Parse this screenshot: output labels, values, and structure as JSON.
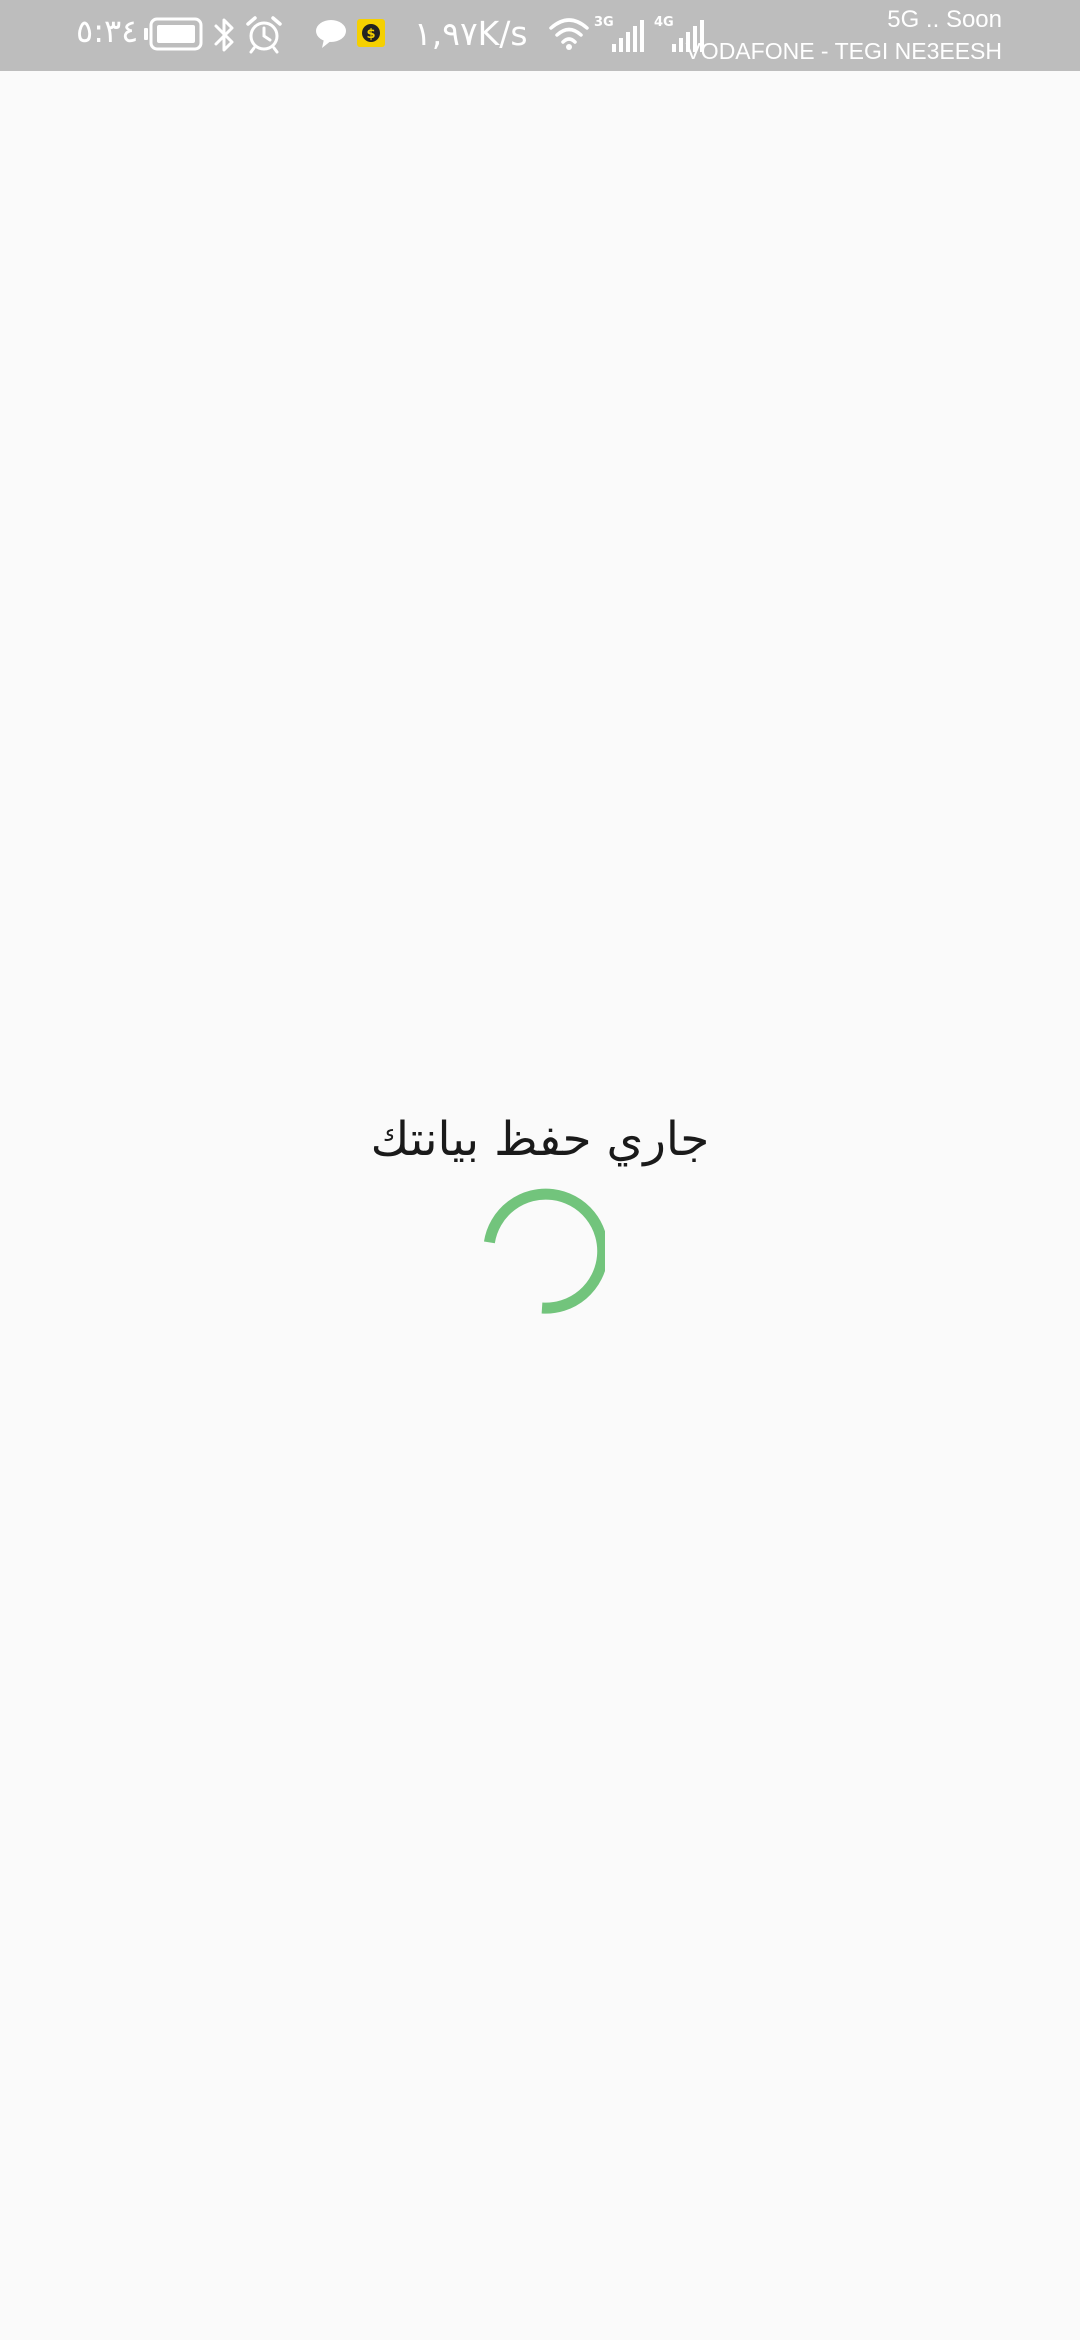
{
  "status_bar": {
    "time": "٥:٣٤",
    "net_speed": "١,٩٧K/s",
    "network_3g_label": "3G",
    "network_4g_label": "4G",
    "carrier_line1": "5G .. Soon",
    "carrier_line2": "VODAFONE - TEGI NE3EESH",
    "battery_level": 0.8,
    "icons": [
      "battery-icon",
      "bluetooth-icon",
      "alarm-icon",
      "chat-icon",
      "money-app-icon",
      "wifi-icon",
      "signal-3g-icon",
      "signal-4g-icon"
    ]
  },
  "main": {
    "loading_text": "جاري حفظ بيانتك",
    "spinner_color": "#72c47c"
  },
  "colors": {
    "status_bar_bg": "#bdbdbd",
    "page_bg": "#fafafa",
    "money_icon_bg": "#f5d000"
  }
}
